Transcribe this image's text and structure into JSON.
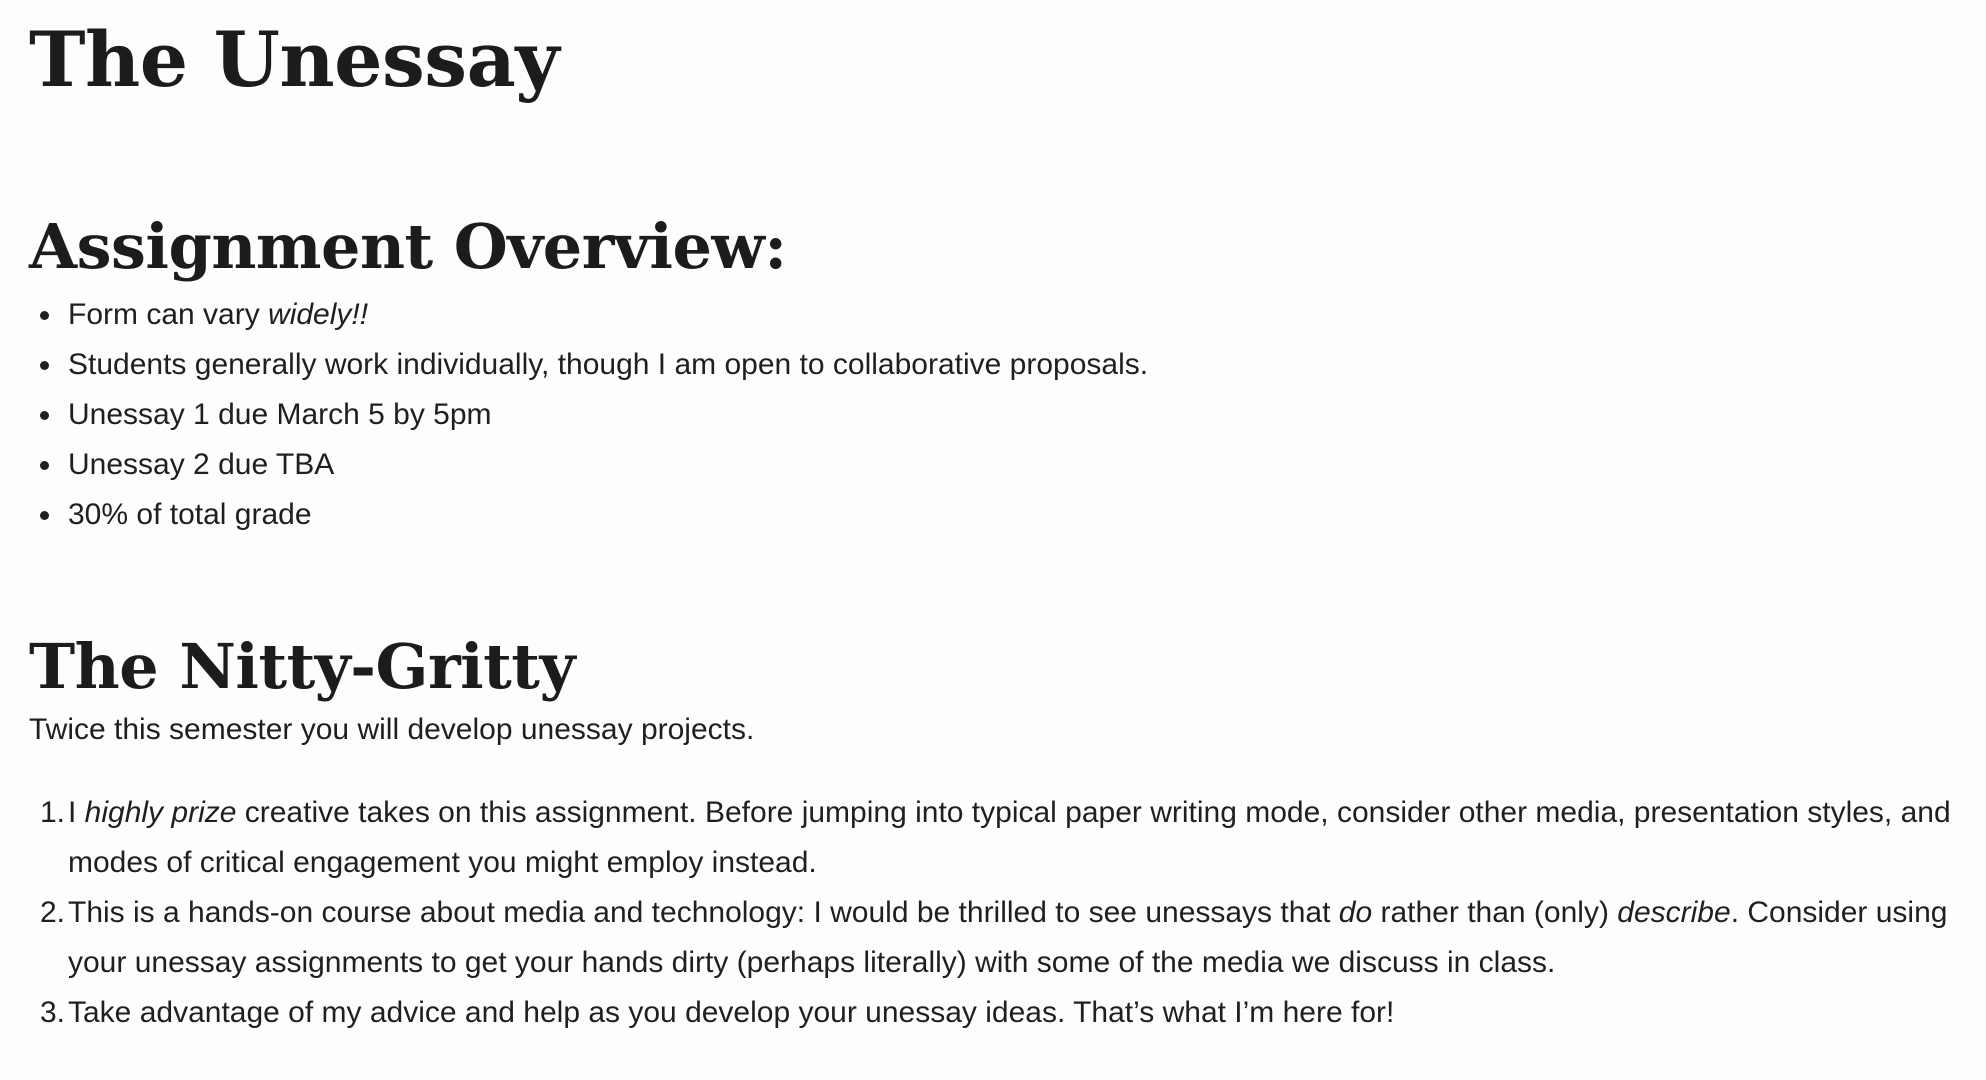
{
  "title": "The Unessay",
  "overview": {
    "heading": "Assignment Overview:",
    "bullets": [
      {
        "before": "Form can vary ",
        "em": "widely!!",
        "after": ""
      },
      {
        "before": "Students generally work individually, though I am open to collaborative proposals.",
        "em": "",
        "after": ""
      },
      {
        "before": "Unessay 1 due March 5 by 5pm",
        "em": "",
        "after": ""
      },
      {
        "before": "Unessay 2 due TBA",
        "em": "",
        "after": ""
      },
      {
        "before": "30% of total grade",
        "em": "",
        "after": ""
      }
    ]
  },
  "nitty_gritty": {
    "heading": "The Nitty-Gritty",
    "intro": "Twice this semester you will develop unessay projects.",
    "items": [
      {
        "number": "1.",
        "part1": "I ",
        "em1": "highly prize",
        "part2": " creative takes on this assignment. Before jumping into typical paper writing mode, consider other media, presentation styles, and modes of critical engagement you might employ instead.",
        "em2": "",
        "part3": ""
      },
      {
        "number": "2.",
        "part1": "This is a hands-on course about media and technology: I would be thrilled to see unessays that ",
        "em1": "do",
        "part2": " rather than (only) ",
        "em2": "describe",
        "part3": ". Consider using your unessay assignments to get your hands dirty (perhaps literally) with some of the media we discuss in class."
      },
      {
        "number": "3.",
        "part1": "Take advantage of my advice and help as you develop your unessay ideas. That’s what I’m here for!",
        "em1": "",
        "part2": "",
        "em2": "",
        "part3": ""
      }
    ]
  }
}
